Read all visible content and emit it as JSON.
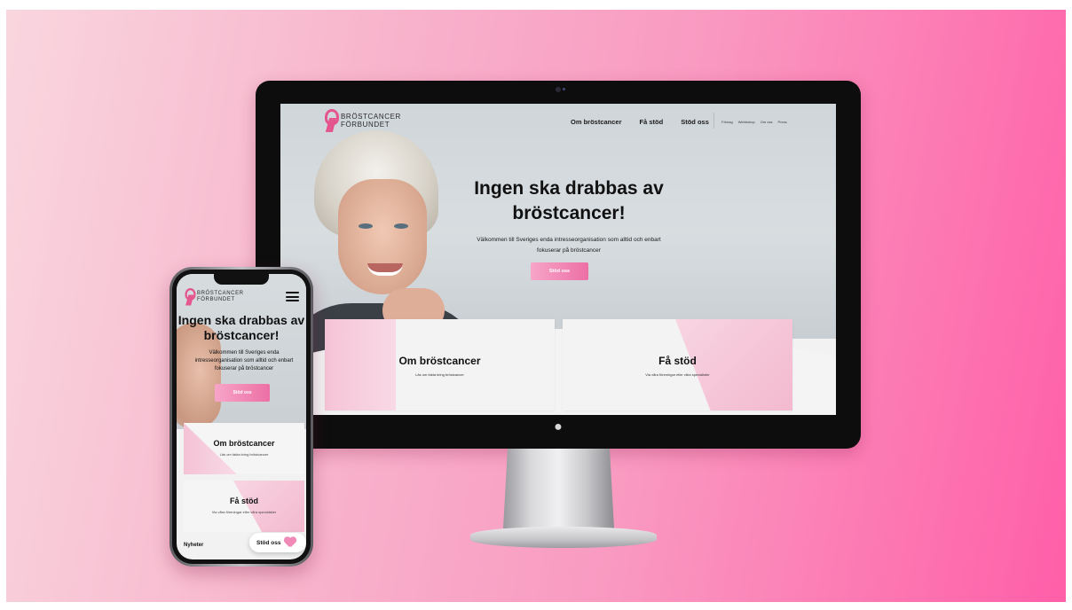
{
  "brand": {
    "name_line1": "BRÖSTCANCER",
    "name_line2": "FÖRBUNDET",
    "accent": "#e4548d"
  },
  "desktop": {
    "nav_main": [
      "Om bröstcancer",
      "Få stöd",
      "Stöd oss"
    ],
    "nav_secondary": [
      "Förnag",
      "Webbshop",
      "Om oss",
      "Press"
    ],
    "hero": {
      "title_line1": "Ingen ska drabbas av",
      "title_line2": "bröstcancer!",
      "subtitle_line1": "Välkommen till Sveriges enda intresseorganisation som alltid och enbart",
      "subtitle_line2": "fokuserar på bröstcancer",
      "cta": "Stöd oss"
    },
    "cards": [
      {
        "title": "Om bröstcancer",
        "subtitle": "Läs om fakta kring bröstcancer"
      },
      {
        "title": "Få stöd",
        "subtitle": "Via våra föreningar eller våra specialister"
      }
    ]
  },
  "mobile": {
    "hero": {
      "title_line1": "Ingen ska drabbas av",
      "title_line2": "bröstcancer!",
      "subtitle": "Välkommen till Sveriges enda intresseorganisation som alltid och enbart fokuserar på bröstcancer",
      "cta": "Stöd oss"
    },
    "cards": [
      {
        "title": "Om bröstcancer",
        "subtitle": "Läs om fakta kring bröstcancer"
      },
      {
        "title": "Få stöd",
        "subtitle": "Via våra föreningar eller våra specialister"
      }
    ],
    "news_label": "Nyheter",
    "floating_support_label": "Stöd oss"
  }
}
